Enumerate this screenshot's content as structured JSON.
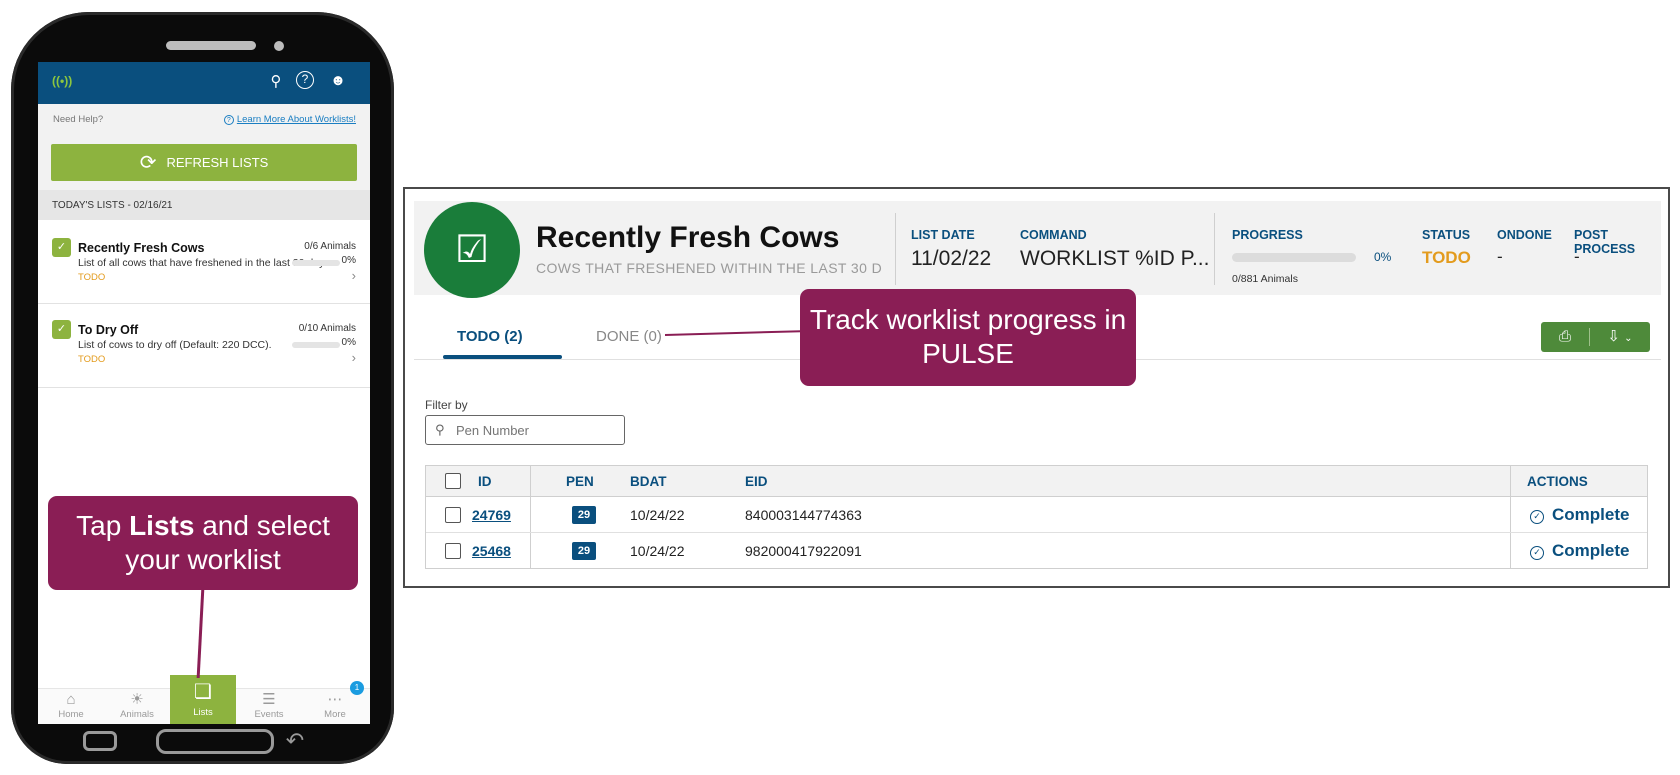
{
  "phone": {
    "app_bar": {
      "signal_icon": "broadcast-icon",
      "search_icon": "search-icon",
      "help_icon": "help-icon",
      "user_icon": "user-icon"
    },
    "need_help": "Need Help?",
    "learn_more": "Learn More About Worklists!",
    "refresh_label": "REFRESH LISTS",
    "lists_header": "TODAY'S LISTS - 02/16/21",
    "items": [
      {
        "title": "Recently Fresh Cows",
        "count": "0/6 Animals",
        "desc": "List of all cows that have freshened in the last 30 days.",
        "pct": "0%",
        "status": "TODO"
      },
      {
        "title": "To Dry Off",
        "count": "0/10 Animals",
        "desc": "List of cows to dry off (Default: 220 DCC).",
        "pct": "0%",
        "status": "TODO"
      }
    ],
    "nav": [
      {
        "label": "Home",
        "icon": "home-icon"
      },
      {
        "label": "Animals",
        "icon": "cow-icon"
      },
      {
        "label": "Lists",
        "icon": "lists-icon"
      },
      {
        "label": "Events",
        "icon": "events-icon"
      },
      {
        "label": "More",
        "icon": "more-icon",
        "badge": "1"
      }
    ]
  },
  "callouts": {
    "phone_pre": "Tap ",
    "phone_bold": "Lists",
    "phone_post": " and select your worklist",
    "pulse": "Track worklist progress in PULSE"
  },
  "worklist": {
    "title": "Recently Fresh Cows",
    "subtitle": "COWS THAT FRESHENED WITHIN THE LAST 30 D",
    "list_date_label": "LIST DATE",
    "list_date": "11/02/22",
    "command_label": "COMMAND",
    "command": "WORKLIST %ID P...",
    "progress_label": "PROGRESS",
    "progress_pct": "0%",
    "progress_value": 0,
    "progress_count": "0/881 Animals",
    "status_label": "STATUS",
    "status": "TODO",
    "ondone_label": "ONDONE",
    "ondone": "-",
    "post_process_label": "POST PROCESS",
    "post_process": "-",
    "tabs": [
      {
        "label": "TODO (2)"
      },
      {
        "label": "DONE (0)"
      }
    ],
    "filter_label": "Filter by",
    "filter_placeholder": "Pen Number",
    "columns": {
      "id": "ID",
      "pen": "PEN",
      "bdat": "BDAT",
      "eid": "EID",
      "actions": "ACTIONS"
    },
    "rows": [
      {
        "id": "24769",
        "pen": "29",
        "bdat": "10/24/22",
        "eid": "840003144774363",
        "action": "Complete"
      },
      {
        "id": "25468",
        "pen": "29",
        "bdat": "10/24/22",
        "eid": "982000417922091",
        "action": "Complete"
      }
    ],
    "colors": {
      "brand_green": "#1a7d3a",
      "navy": "#0a4f7e",
      "todo_orange": "#e39b1d",
      "callout": "#8a1e55",
      "lime": "#8db33f"
    }
  }
}
